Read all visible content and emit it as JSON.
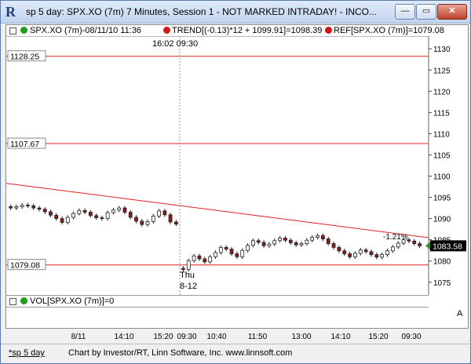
{
  "window": {
    "title": "sp 5 day: SPX.XO (7m) 7 Minutes, Session 1 - NOT MARKED INTRADAY! - INCO...",
    "app_icon": "R",
    "minimize_glyph": "—",
    "maximize_glyph": "▭",
    "close_glyph": "✕"
  },
  "legend": {
    "series": "SPX.XO (7m)-08/11/10 11:36",
    "trend": "TREND[(-0.13)*12 + 1099.91]=1098.39",
    "ref": "REF[SPX.XO (7m)]=1079.08",
    "time": "16:02  09:30"
  },
  "volume": {
    "label": "VOL[SPX.XO (7m)]=0",
    "marker": "A"
  },
  "status": {
    "tab": "*sp 5 day",
    "credit": "Chart by Investor/RT, Linn Software, Inc. www.linnsoft.com"
  },
  "colors": {
    "up": "#ffffff",
    "down": "#8b1c1c",
    "hline": "#e02020",
    "trend": "#e02020",
    "green_dot": "#1e9e1e",
    "red_dot": "#d01818"
  },
  "chart_data": {
    "type": "candlestick",
    "ylim": [
      1072,
      1133
    ],
    "yticks": [
      1075,
      1080,
      1085,
      1090,
      1095,
      1100,
      1105,
      1110,
      1115,
      1120,
      1125,
      1130
    ],
    "x_tick_labels": [
      "8/11",
      "14:10",
      "15:20",
      "09:30",
      "10:40",
      "11:50",
      "13:00",
      "14:10",
      "15:20",
      "09:30"
    ],
    "session_break_label": [
      "Thu",
      "8-12"
    ],
    "ref_lines": [
      {
        "value": 1128.25,
        "label": "1128.25"
      },
      {
        "value": 1107.67,
        "label": "1107.67"
      },
      {
        "value": 1079.08,
        "label": "1079.08"
      }
    ],
    "trend_line": {
      "start": 1098.3,
      "end": 1085.5,
      "annotation": "-1.21%"
    },
    "last_price": "1083.58",
    "session1_closes": [
      1092.5,
      1092.8,
      1093.2,
      1093.0,
      1092.5,
      1092.2,
      1091.6,
      1090.8,
      1090.0,
      1089.1,
      1090.3,
      1091.2,
      1091.9,
      1091.5,
      1090.7,
      1090.2,
      1090.0,
      1091.4,
      1092.0,
      1092.5,
      1091.5,
      1090.3,
      1089.4,
      1088.6,
      1089.3,
      1090.6,
      1091.8,
      1090.9,
      1089.2,
      1088.7
    ],
    "session2_closes": [
      1078.0,
      1080.1,
      1081.2,
      1080.5,
      1079.8,
      1081.0,
      1082.0,
      1083.2,
      1082.8,
      1081.7,
      1081.0,
      1082.5,
      1083.7,
      1084.8,
      1084.4,
      1083.6,
      1084.0,
      1084.8,
      1085.4,
      1084.9,
      1084.3,
      1083.8,
      1084.1,
      1084.9,
      1085.6,
      1086.0,
      1085.2,
      1084.1,
      1083.2,
      1082.4,
      1081.7,
      1081.0,
      1081.8,
      1082.6,
      1082.2,
      1081.5,
      1080.9,
      1081.5,
      1082.4,
      1083.3,
      1084.2,
      1085.0,
      1084.7,
      1084.1,
      1083.58
    ]
  }
}
